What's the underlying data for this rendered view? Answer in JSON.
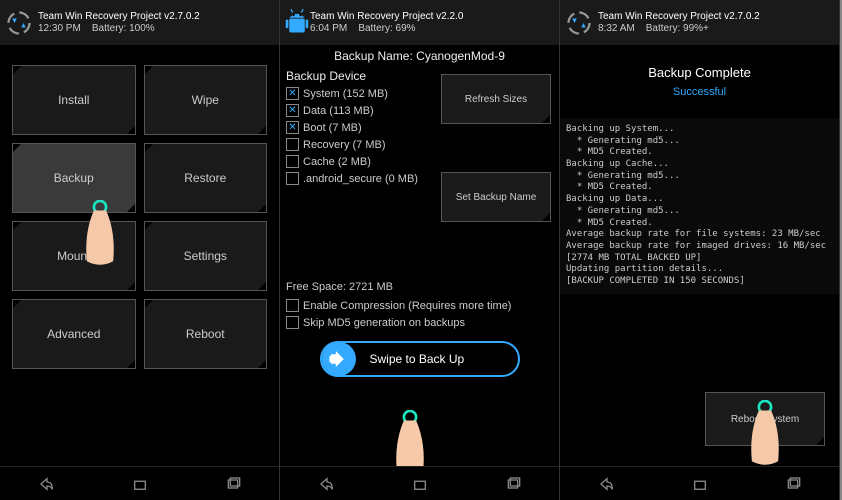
{
  "screens": [
    {
      "title": "Team Win Recovery Project  v2.7.0.2",
      "time": "12:30 PM",
      "battery": "Battery: 100%",
      "tiles": [
        "Install",
        "Wipe",
        "Backup",
        "Restore",
        "Mount",
        "Settings",
        "Advanced",
        "Reboot"
      ]
    },
    {
      "title": "Team Win Recovery Project  v2.2.0",
      "time": "6:04 PM",
      "battery": "Battery: 69%",
      "backup_name": "Backup Name: CyanogenMod-9",
      "backup_device": "Backup Device",
      "items": [
        {
          "label": "System (152 MB)",
          "checked": true
        },
        {
          "label": "Data (113 MB)",
          "checked": true
        },
        {
          "label": "Boot (7 MB)",
          "checked": true
        },
        {
          "label": "Recovery (7 MB)",
          "checked": false
        },
        {
          "label": "Cache (2 MB)",
          "checked": false
        },
        {
          "label": ".android_secure (0 MB)",
          "checked": false
        }
      ],
      "refresh": "Refresh Sizes",
      "set_name": "Set Backup Name",
      "free_space": "Free Space: 2721 MB",
      "options": [
        {
          "label": "Enable Compression (Requires more time)",
          "checked": false
        },
        {
          "label": "Skip MD5 generation on backups",
          "checked": false
        }
      ],
      "swipe": "Swipe to Back Up"
    },
    {
      "title": "Team Win Recovery Project  v2.7.0.2",
      "time": "8:32 AM",
      "battery": "Battery: 99%+",
      "status_title": "Backup Complete",
      "status_text": "Successful",
      "log": "Backing up System...\n  * Generating md5...\n  * MD5 Created.\nBacking up Cache...\n  * Generating md5...\n  * MD5 Created.\nBacking up Data...\n  * Generating md5...\n  * MD5 Created.\nAverage backup rate for file systems: 23 MB/sec\nAverage backup rate for imaged drives: 16 MB/sec\n[2774 MB TOTAL BACKED UP]\nUpdating partition details...\n[BACKUP COMPLETED IN 150 SECONDS]",
      "reboot": "Reboot System"
    }
  ]
}
